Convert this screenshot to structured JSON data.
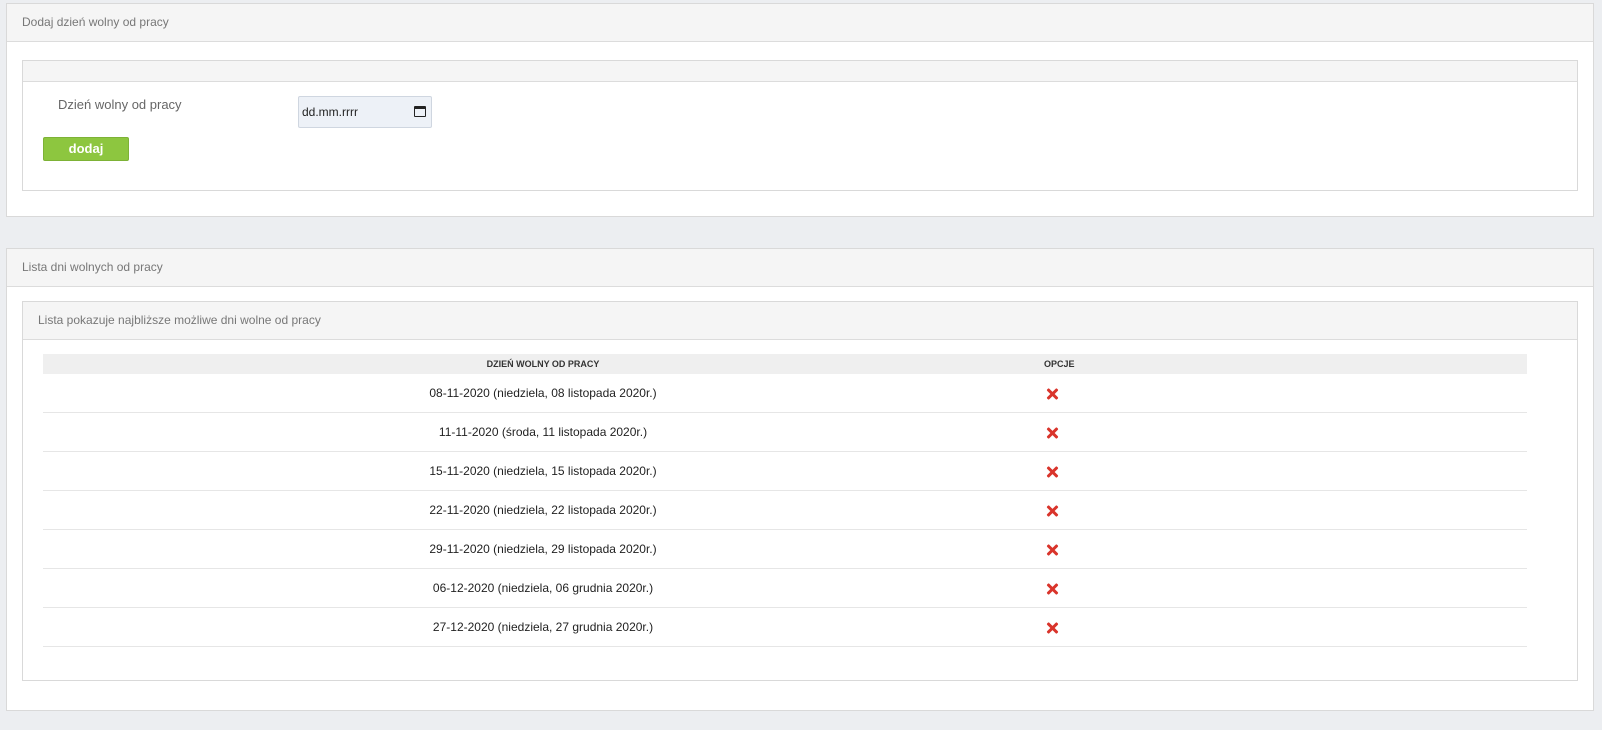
{
  "add_panel": {
    "title": "Dodaj dzień wolny od pracy",
    "field_label": "Dzień wolny od pracy",
    "date_placeholder": "dd.mm.rrrr",
    "button_label": "dodaj"
  },
  "list_panel": {
    "title": "Lista dni wolnych od pracy",
    "subtitle": "Lista pokazuje najbliższe możliwe dni wolne od pracy",
    "columns": [
      "DZIEŃ WOLNY OD PRACY",
      "OPCJE"
    ],
    "rows": [
      "08-11-2020 (niedziela, 08 listopada 2020r.)",
      "11-11-2020 (środa, 11 listopada 2020r.)",
      "15-11-2020 (niedziela, 15 listopada 2020r.)",
      "22-11-2020 (niedziela, 22 listopada 2020r.)",
      "29-11-2020 (niedziela, 29 listopada 2020r.)",
      "06-12-2020 (niedziela, 06 grudnia 2020r.)",
      "27-12-2020 (niedziela, 27 grudnia 2020r.)"
    ],
    "row_action_icon": "delete-x-icon"
  },
  "colors": {
    "accent_green": "#8dc63f",
    "delete_red": "#d9342b",
    "page_bg": "#eceef1"
  }
}
